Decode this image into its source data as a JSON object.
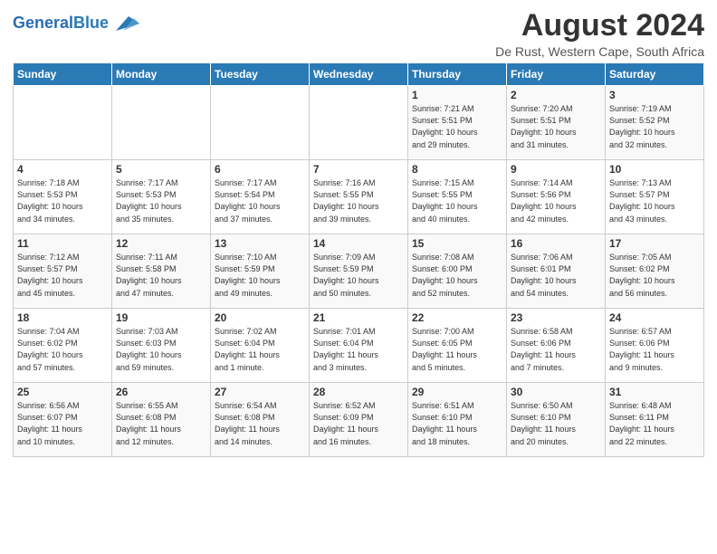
{
  "header": {
    "logo_general": "General",
    "logo_blue": "Blue",
    "month_year": "August 2024",
    "location": "De Rust, Western Cape, South Africa"
  },
  "days_of_week": [
    "Sunday",
    "Monday",
    "Tuesday",
    "Wednesday",
    "Thursday",
    "Friday",
    "Saturday"
  ],
  "weeks": [
    [
      {
        "day": "",
        "info": ""
      },
      {
        "day": "",
        "info": ""
      },
      {
        "day": "",
        "info": ""
      },
      {
        "day": "",
        "info": ""
      },
      {
        "day": "1",
        "info": "Sunrise: 7:21 AM\nSunset: 5:51 PM\nDaylight: 10 hours\nand 29 minutes."
      },
      {
        "day": "2",
        "info": "Sunrise: 7:20 AM\nSunset: 5:51 PM\nDaylight: 10 hours\nand 31 minutes."
      },
      {
        "day": "3",
        "info": "Sunrise: 7:19 AM\nSunset: 5:52 PM\nDaylight: 10 hours\nand 32 minutes."
      }
    ],
    [
      {
        "day": "4",
        "info": "Sunrise: 7:18 AM\nSunset: 5:53 PM\nDaylight: 10 hours\nand 34 minutes."
      },
      {
        "day": "5",
        "info": "Sunrise: 7:17 AM\nSunset: 5:53 PM\nDaylight: 10 hours\nand 35 minutes."
      },
      {
        "day": "6",
        "info": "Sunrise: 7:17 AM\nSunset: 5:54 PM\nDaylight: 10 hours\nand 37 minutes."
      },
      {
        "day": "7",
        "info": "Sunrise: 7:16 AM\nSunset: 5:55 PM\nDaylight: 10 hours\nand 39 minutes."
      },
      {
        "day": "8",
        "info": "Sunrise: 7:15 AM\nSunset: 5:55 PM\nDaylight: 10 hours\nand 40 minutes."
      },
      {
        "day": "9",
        "info": "Sunrise: 7:14 AM\nSunset: 5:56 PM\nDaylight: 10 hours\nand 42 minutes."
      },
      {
        "day": "10",
        "info": "Sunrise: 7:13 AM\nSunset: 5:57 PM\nDaylight: 10 hours\nand 43 minutes."
      }
    ],
    [
      {
        "day": "11",
        "info": "Sunrise: 7:12 AM\nSunset: 5:57 PM\nDaylight: 10 hours\nand 45 minutes."
      },
      {
        "day": "12",
        "info": "Sunrise: 7:11 AM\nSunset: 5:58 PM\nDaylight: 10 hours\nand 47 minutes."
      },
      {
        "day": "13",
        "info": "Sunrise: 7:10 AM\nSunset: 5:59 PM\nDaylight: 10 hours\nand 49 minutes."
      },
      {
        "day": "14",
        "info": "Sunrise: 7:09 AM\nSunset: 5:59 PM\nDaylight: 10 hours\nand 50 minutes."
      },
      {
        "day": "15",
        "info": "Sunrise: 7:08 AM\nSunset: 6:00 PM\nDaylight: 10 hours\nand 52 minutes."
      },
      {
        "day": "16",
        "info": "Sunrise: 7:06 AM\nSunset: 6:01 PM\nDaylight: 10 hours\nand 54 minutes."
      },
      {
        "day": "17",
        "info": "Sunrise: 7:05 AM\nSunset: 6:02 PM\nDaylight: 10 hours\nand 56 minutes."
      }
    ],
    [
      {
        "day": "18",
        "info": "Sunrise: 7:04 AM\nSunset: 6:02 PM\nDaylight: 10 hours\nand 57 minutes."
      },
      {
        "day": "19",
        "info": "Sunrise: 7:03 AM\nSunset: 6:03 PM\nDaylight: 10 hours\nand 59 minutes."
      },
      {
        "day": "20",
        "info": "Sunrise: 7:02 AM\nSunset: 6:04 PM\nDaylight: 11 hours\nand 1 minute."
      },
      {
        "day": "21",
        "info": "Sunrise: 7:01 AM\nSunset: 6:04 PM\nDaylight: 11 hours\nand 3 minutes."
      },
      {
        "day": "22",
        "info": "Sunrise: 7:00 AM\nSunset: 6:05 PM\nDaylight: 11 hours\nand 5 minutes."
      },
      {
        "day": "23",
        "info": "Sunrise: 6:58 AM\nSunset: 6:06 PM\nDaylight: 11 hours\nand 7 minutes."
      },
      {
        "day": "24",
        "info": "Sunrise: 6:57 AM\nSunset: 6:06 PM\nDaylight: 11 hours\nand 9 minutes."
      }
    ],
    [
      {
        "day": "25",
        "info": "Sunrise: 6:56 AM\nSunset: 6:07 PM\nDaylight: 11 hours\nand 10 minutes."
      },
      {
        "day": "26",
        "info": "Sunrise: 6:55 AM\nSunset: 6:08 PM\nDaylight: 11 hours\nand 12 minutes."
      },
      {
        "day": "27",
        "info": "Sunrise: 6:54 AM\nSunset: 6:08 PM\nDaylight: 11 hours\nand 14 minutes."
      },
      {
        "day": "28",
        "info": "Sunrise: 6:52 AM\nSunset: 6:09 PM\nDaylight: 11 hours\nand 16 minutes."
      },
      {
        "day": "29",
        "info": "Sunrise: 6:51 AM\nSunset: 6:10 PM\nDaylight: 11 hours\nand 18 minutes."
      },
      {
        "day": "30",
        "info": "Sunrise: 6:50 AM\nSunset: 6:10 PM\nDaylight: 11 hours\nand 20 minutes."
      },
      {
        "day": "31",
        "info": "Sunrise: 6:48 AM\nSunset: 6:11 PM\nDaylight: 11 hours\nand 22 minutes."
      }
    ]
  ]
}
